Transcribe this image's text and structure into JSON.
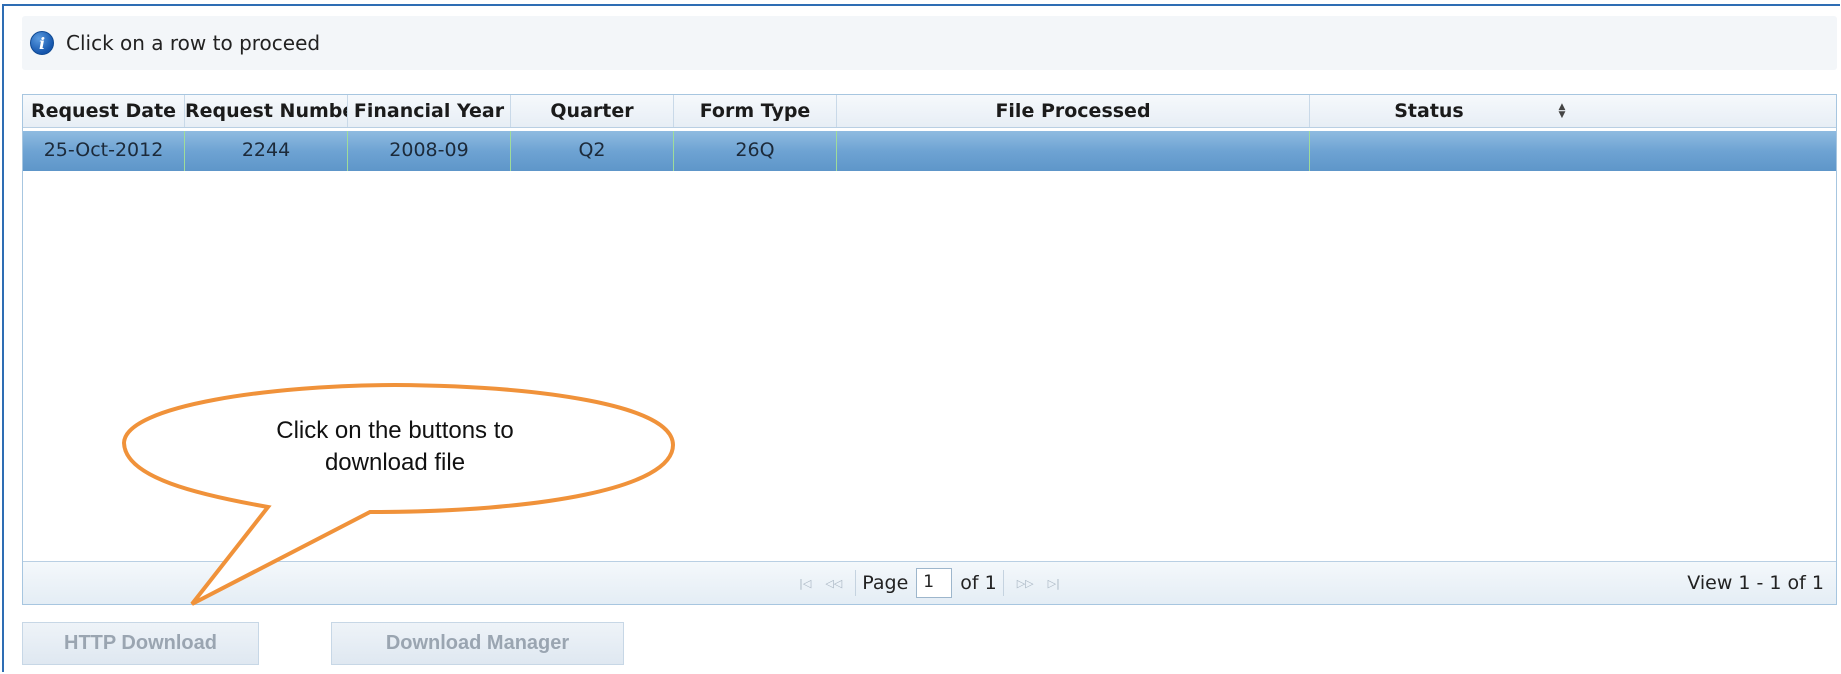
{
  "info": {
    "icon": "info-icon",
    "message": "Click on a row to proceed"
  },
  "grid": {
    "columns": [
      "Request Date",
      "Request Number",
      "Financial Year",
      "Quarter",
      "Form Type",
      "File Processed",
      "Status"
    ],
    "rows": [
      {
        "request_date": "25-Oct-2012",
        "request_number": "2244",
        "financial_year": "2008-09",
        "quarter": "Q2",
        "form_type": "26Q",
        "file_processed": "",
        "status": ""
      }
    ]
  },
  "pager": {
    "page_label": "Page",
    "page_value": "1",
    "of_label": "of 1",
    "view_text": "View 1 - 1 of 1"
  },
  "buttons": {
    "http_download": "HTTP Download",
    "download_manager": "Download Manager"
  },
  "callout": {
    "line1": "Click on the buttons to",
    "line2": "download file"
  },
  "colors": {
    "callout_stroke": "#f0923a",
    "row_selected": "#6ea3d3",
    "frame": "#2e6db4"
  }
}
